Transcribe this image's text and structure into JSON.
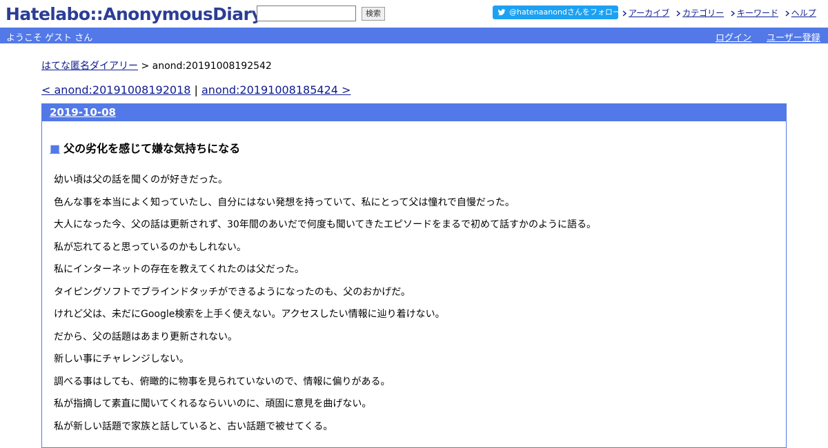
{
  "header": {
    "logo": "Hatelabo::AnonymousDiary",
    "search_button": "検索",
    "search_value": "",
    "twitter_follow": "@hatenaanondさんをフォロー",
    "nav": [
      "アーカイブ",
      "カテゴリー",
      "キーワード",
      "ヘルプ"
    ]
  },
  "userbar": {
    "welcome": "ようこそ ゲスト さん",
    "login": "ログイン",
    "register": "ユーザー登録"
  },
  "breadcrumb": {
    "home": "はてな匿名ダイアリー",
    "separator": " > ",
    "current": "anond:20191008192542"
  },
  "pager": {
    "prev": "< anond:20191008192018",
    "separator": " | ",
    "next": "anond:20191008185424 >"
  },
  "entry": {
    "date": "2019-10-08",
    "title_marker": "■",
    "title": "父の劣化を感じて嫌な気持ちになる",
    "paragraphs": [
      "幼い頃は父の話を聞くのが好きだった。",
      "色んな事を本当によく知っていたし、自分にはない発想を持っていて、私にとって父は憧れで自慢だった。",
      "大人になった今、父の話は更新されず、30年間のあいだで何度も聞いてきたエピソードをまるで初めて話すかのように語る。",
      "私が忘れてると思っているのかもしれない。",
      "私にインターネットの存在を教えてくれたのは父だった。",
      "タイピングソフトでブラインドタッチができるようになったのも、父のおかげだ。",
      "けれど父は、未だにGoogle検索を上手く使えない。アクセスしたい情報に辿り着けない。",
      "だから、父の話題はあまり更新されない。",
      "新しい事にチャレンジしない。",
      "調べる事はしても、俯瞰的に物事を見られていないので、情報に偏りがある。",
      "私が指摘して素直に聞いてくれるならいいのに、頑固に意見を曲げない。",
      "私が新しい話題で家族と話していると、古い話題で被せてくる。"
    ]
  },
  "colors": {
    "brand_blue": "#5279e7",
    "logo_blue": "#2c3d96",
    "link": "#0d1b8f",
    "twitter": "#1da1f2"
  }
}
